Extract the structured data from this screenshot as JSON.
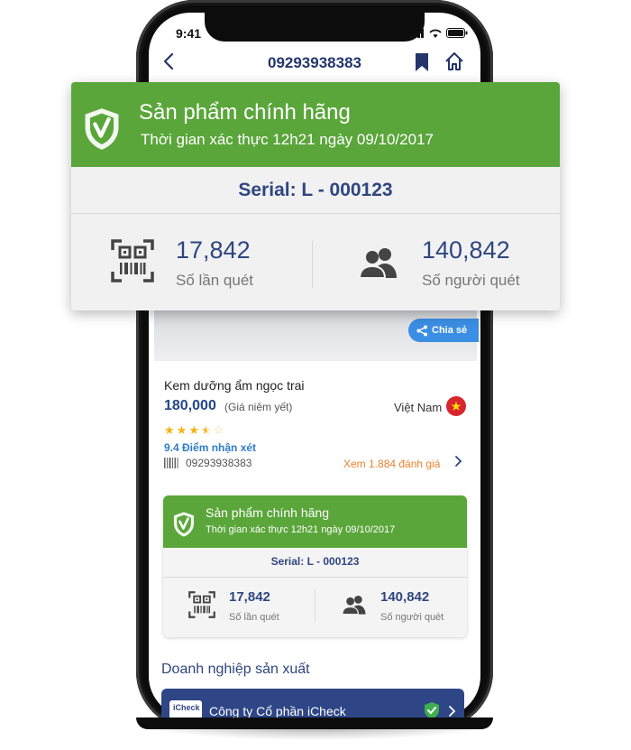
{
  "status_bar": {
    "time": "9:41"
  },
  "navbar": {
    "title": "09293938383"
  },
  "share": {
    "label": "Chia sẻ"
  },
  "product": {
    "name": "Kem dưỡng ẩm ngọc trai",
    "price": "180,000",
    "price_note": "(Giá niêm yết)",
    "origin": "Việt Nam",
    "rating_stars": 3.5,
    "rating_max": 5,
    "score_text": "9.4 Điểm nhận xét",
    "barcode": "09293938383",
    "reviews_link": "Xem 1.884 đánh giá"
  },
  "verification": {
    "title": "Sản phẩm chính hãng",
    "subtitle": "Thời gian xác thực 12h21 ngày 09/10/2017",
    "serial": "Serial: L - 000123",
    "scan_count": "17,842",
    "scan_count_label": "Số lần quét",
    "scanner_count": "140,842",
    "scanner_count_label": "Số người quét"
  },
  "manufacturer": {
    "section_title": "Doanh nghiệp sản xuất",
    "logo_text": "iCheck",
    "company_name": "Công ty Cổ phần iCheck"
  },
  "colors": {
    "verified_green": "#5aa63a",
    "brand_navy": "#2f4680",
    "share_blue": "#3a8ee3",
    "review_orange": "#e9822c",
    "star_yellow": "#f4b315"
  },
  "icons": [
    "back-arrow-icon",
    "bookmark-icon",
    "home-icon",
    "share-icon",
    "shield-check-icon",
    "qr-scan-icon",
    "users-icon",
    "barcode-icon",
    "chevron-right-icon",
    "vietnam-flag-icon",
    "verified-check-icon"
  ]
}
